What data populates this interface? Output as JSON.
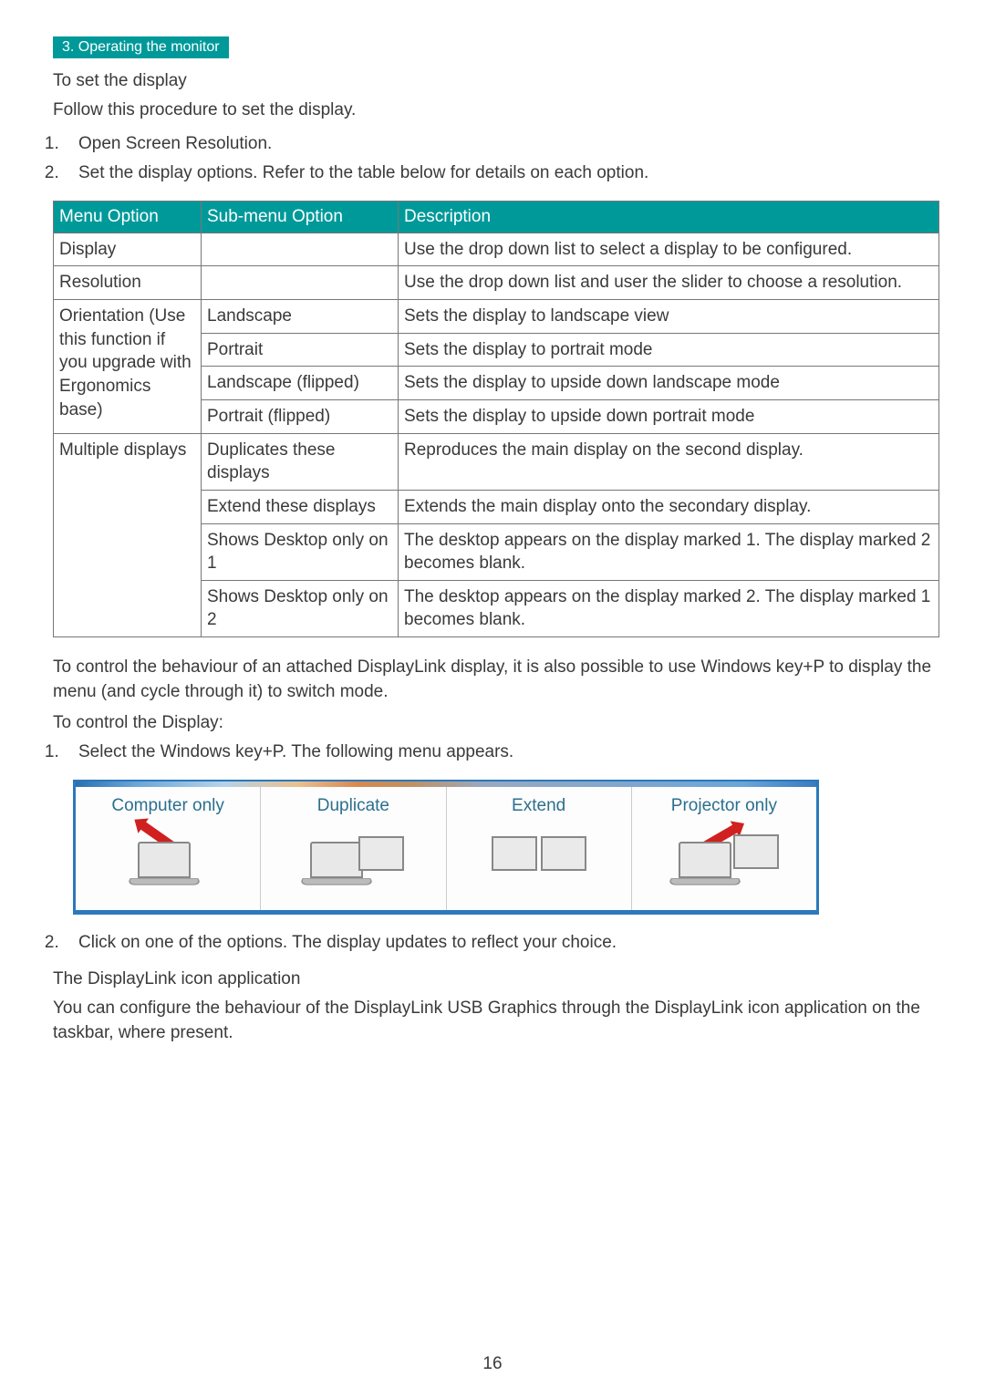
{
  "sectionTab": "3. Operating the monitor",
  "headingSetDisplay": "To set the display",
  "paraFollowProcedure": "Follow this procedure to set the display.",
  "stepOpenScreenRes": "Open Screen Resolution.",
  "stepSetOptions": "Set the display options. Refer to the table below for details on each option.",
  "tableHeaders": {
    "menuOption": "Menu Option",
    "subMenuOption": "Sub-menu Option",
    "description": "Description"
  },
  "tableRows": {
    "display": {
      "menu": "Display",
      "sub": "",
      "desc": "Use the drop down list to select a display to be configured."
    },
    "resolution": {
      "menu": "Resolution",
      "sub": "",
      "desc": "Use the drop down list and user the slider to choose a resolution."
    },
    "orientation": {
      "menu": "Orientation (Use this function if you upgrade with Ergonomics base)",
      "r1": {
        "sub": "Landscape",
        "desc": "Sets the display to landscape view"
      },
      "r2": {
        "sub": "Portrait",
        "desc": "Sets the display to portrait mode"
      },
      "r3": {
        "sub": "Landscape (flipped)",
        "desc": "Sets the display to upside down landscape mode"
      },
      "r4": {
        "sub": "Portrait (flipped)",
        "desc": "Sets the display to upside down portrait mode"
      }
    },
    "multiple": {
      "menu": "Multiple displays",
      "r1": {
        "sub": "Duplicates these displays",
        "desc": "Reproduces the main display on the second display."
      },
      "r2": {
        "sub": "Extend these displays",
        "desc": "Extends the main display onto the secondary display."
      },
      "r3": {
        "sub": "Shows Desktop only on 1",
        "desc": "The desktop appears on the display marked 1. The display marked 2 becomes blank."
      },
      "r4": {
        "sub": "Shows Desktop only on 2",
        "desc": "The desktop appears on the display marked 2. The display marked 1 becomes blank."
      }
    }
  },
  "paraControlBehaviour": "To control the behaviour of an attached DisplayLink display, it is also possible to use Windows key+P to display the menu (and cycle through it) to switch mode.",
  "headingControlDisplay": "To control the Display:",
  "stepWinKeyP": "Select the Windows key+P. The following menu appears.",
  "displayModes": {
    "computerOnly": "Computer only",
    "duplicate": "Duplicate",
    "extend": "Extend",
    "projectorOnly": "Projector only"
  },
  "stepClickOption": "Click on one of the options. The display updates to reflect your choice.",
  "headingIconApp": "The DisplayLink icon application",
  "paraIconApp": "You can configure the behaviour of the DisplayLink USB Graphics through the DisplayLink icon application on the taskbar, where present.",
  "pageNumber": "16"
}
